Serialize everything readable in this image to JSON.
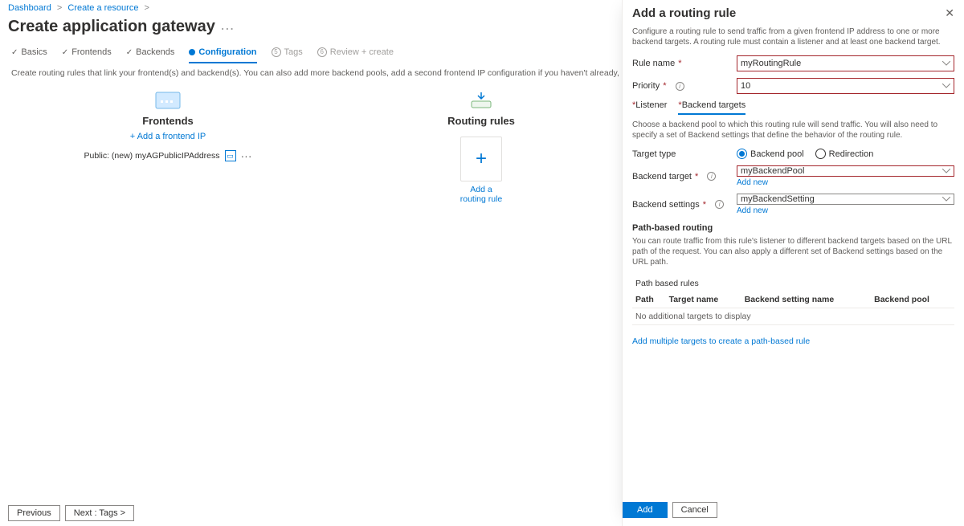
{
  "breadcrumb": {
    "item1": "Dashboard",
    "item2": "Create a resource"
  },
  "page_title": "Create application gateway",
  "tabs": {
    "basics": "Basics",
    "frontends": "Frontends",
    "backends": "Backends",
    "configuration": "Configuration",
    "tags_num": "5",
    "tags": "Tags",
    "review_num": "6",
    "review": "Review + create"
  },
  "desc": "Create routing rules that link your frontend(s) and backend(s). You can also add more backend pools, add a second frontend IP configuration if you haven't already, or edit previous configurations.",
  "frontends": {
    "title": "Frontends",
    "add_link": "+ Add a frontend IP",
    "item_label": "Public: (new) myAGPublicIPAddress"
  },
  "routing": {
    "title": "Routing rules",
    "card_caption": "Add a routing rule"
  },
  "footer": {
    "prev": "Previous",
    "next": "Next : Tags >"
  },
  "panel": {
    "title": "Add a routing rule",
    "desc": "Configure a routing rule to send traffic from a given frontend IP address to one or more backend targets. A routing rule must contain a listener and at least one backend target.",
    "rule_name_label": "Rule name",
    "rule_name_value": "myRoutingRule",
    "priority_label": "Priority",
    "priority_value": "10",
    "tab_listener": "Listener",
    "tab_backend": "Backend targets",
    "tab_desc": "Choose a backend pool to which this routing rule will send traffic. You will also need to specify a set of Backend settings that define the behavior of the routing rule.",
    "target_type_label": "Target type",
    "target_type_pool": "Backend pool",
    "target_type_redir": "Redirection",
    "backend_target_label": "Backend target",
    "backend_target_value": "myBackendPool",
    "backend_settings_label": "Backend settings",
    "backend_settings_value": "myBackendSetting",
    "add_new": "Add new",
    "path_heading": "Path-based routing",
    "path_desc": "You can route traffic from this rule's listener to different backend targets based on the URL path of the request. You can also apply a different set of Backend settings based on the URL path.",
    "table": {
      "caption": "Path based rules",
      "h1": "Path",
      "h2": "Target name",
      "h3": "Backend setting name",
      "h4": "Backend pool",
      "empty": "No additional targets to display"
    },
    "add_multi": "Add multiple targets to create a path-based rule",
    "btn_add": "Add",
    "btn_cancel": "Cancel"
  }
}
